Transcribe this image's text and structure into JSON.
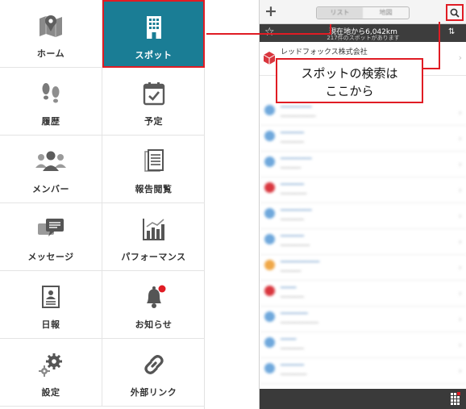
{
  "menu": {
    "items": [
      {
        "label": "ホーム",
        "icon": "map-pin-icon"
      },
      {
        "label": "スポット",
        "icon": "building-icon",
        "selected": true
      },
      {
        "label": "履歴",
        "icon": "footprints-icon"
      },
      {
        "label": "予定",
        "icon": "calendar-check-icon"
      },
      {
        "label": "メンバー",
        "icon": "people-icon"
      },
      {
        "label": "報告閲覧",
        "icon": "document-icon"
      },
      {
        "label": "メッセージ",
        "icon": "chat-bubbles-icon"
      },
      {
        "label": "パフォーマンス",
        "icon": "bar-chart-icon"
      },
      {
        "label": "日報",
        "icon": "daily-report-icon"
      },
      {
        "label": "お知らせ",
        "icon": "bell-icon",
        "badge": true
      },
      {
        "label": "設定",
        "icon": "gears-icon"
      },
      {
        "label": "外部リンク",
        "icon": "link-icon"
      }
    ]
  },
  "phone": {
    "topbar": {
      "add_symbol": "+",
      "segment_tabs": [
        "リスト",
        "地図"
      ],
      "search_icon": "search-icon"
    },
    "status": {
      "distance": "現在地から6,042km",
      "count": "217件のスポットがあります"
    },
    "first_row": {
      "name": "レッドフォックス株式会社"
    },
    "colors": {
      "accent": "#1a7d95",
      "highlight": "#e01c24",
      "pin_blue": "#6fa8dc",
      "pin_orange": "#f0a848",
      "pin_red": "#d9363e"
    }
  },
  "callout": {
    "line1": "スポットの検索は",
    "line2": "ここから"
  }
}
